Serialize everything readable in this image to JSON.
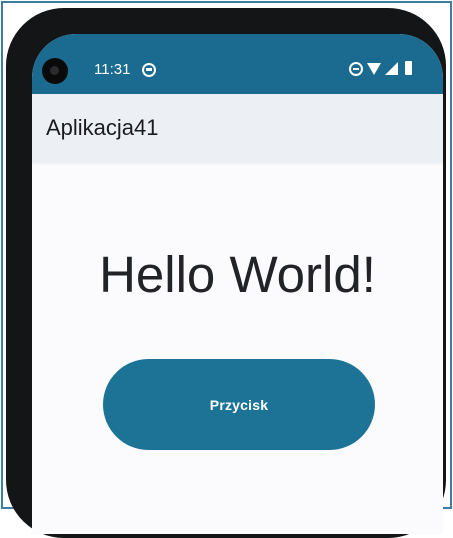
{
  "status_bar": {
    "time": "11:31",
    "icons": [
      "notification-icon",
      "do-not-disturb-icon",
      "wifi-icon",
      "signal-icon",
      "battery-icon"
    ]
  },
  "app_bar": {
    "title": "Aplikacja41"
  },
  "main": {
    "hello_text": "Hello World!",
    "button_label": "Przycisk"
  },
  "colors": {
    "status_bar": "#1a6b8f",
    "button": "#1c7396",
    "app_bar": "#ecf0f5",
    "background": "#fbfafd"
  }
}
